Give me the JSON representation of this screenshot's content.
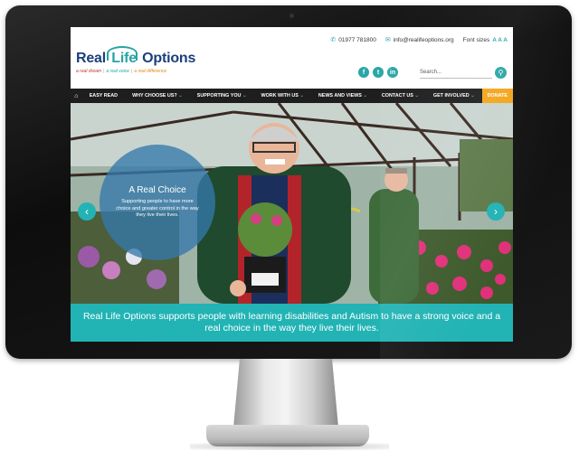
{
  "topbar": {
    "phone": "01977 781800",
    "email": "info@realifeoptions.org",
    "font_sizes_label": "Font sizes",
    "font_sizes_value": "A A A"
  },
  "logo": {
    "title_part1": "Real",
    "title_part2": "Life",
    "title_part3": "Options",
    "tag1": "a real dream",
    "tag2": "a real voice",
    "tag3": "a real difference",
    "separator": "|"
  },
  "social": {
    "facebook": "f",
    "twitter": "t",
    "linkedin": "in"
  },
  "search": {
    "placeholder": "Search...",
    "button_icon": "search-icon"
  },
  "nav": {
    "items": [
      {
        "label": "EASY READ"
      },
      {
        "label": "WHY CHOOSE US?"
      },
      {
        "label": "SUPPORTING YOU"
      },
      {
        "label": "WORK WITH US"
      },
      {
        "label": "NEWS AND VIEWS"
      },
      {
        "label": "CONTACT US"
      },
      {
        "label": "GET INVOLVED"
      }
    ],
    "donate": "DONATE"
  },
  "hero": {
    "title": "A Real Choice",
    "text": "Supporting people to have more choice and greater control in the way they live their lives."
  },
  "caption": "Real Life Options supports people with learning disabilities and Autism to have a strong voice and a real choice in the way they live their lives.",
  "colors": {
    "accent": "#22b3b4",
    "navy": "#1c3f7a",
    "donate": "#f4a51c",
    "nav_bg": "#1e1e1e"
  }
}
